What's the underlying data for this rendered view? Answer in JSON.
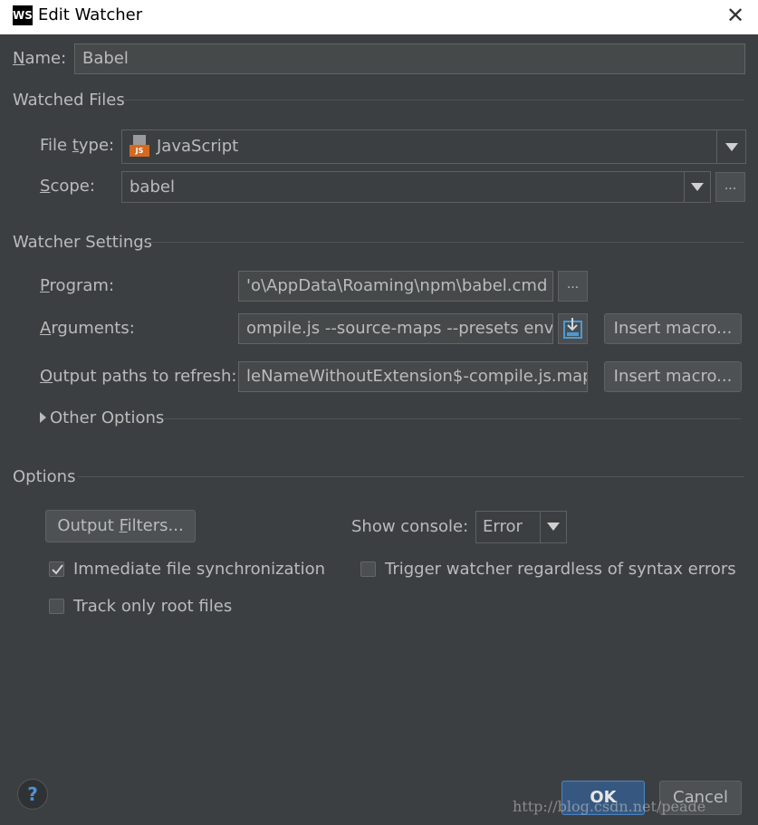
{
  "window": {
    "title": "Edit Watcher",
    "app_icon": "WS"
  },
  "name": {
    "label_prefix": "N",
    "label_rest": "ame:",
    "value": "Babel"
  },
  "watched_files": {
    "heading": "Watched Files",
    "file_type": {
      "label_pre": "File ",
      "label_u": "t",
      "label_post": "ype:",
      "value": "JavaScript",
      "badge": "JS"
    },
    "scope": {
      "label_u": "S",
      "label_post": "cope:",
      "value": "babel"
    }
  },
  "watcher_settings": {
    "heading": "Watcher Settings",
    "program": {
      "label_u": "P",
      "label_post": "rogram:",
      "value": "'o\\AppData\\Roaming\\npm\\babel.cmd"
    },
    "arguments": {
      "label_u": "A",
      "label_post": "rguments:",
      "value": "ompile.js --source-maps --presets env"
    },
    "output_paths": {
      "label_u": "O",
      "label_post": "utput paths to refresh:",
      "value": "leNameWithoutExtension$-compile.js.map"
    },
    "insert_macro_label": "Insert macro...",
    "other_options": "Other Options"
  },
  "options": {
    "heading": "Options",
    "output_filters_pre": "Output ",
    "output_filters_u": "F",
    "output_filters_post": "ilters...",
    "show_console_label": "Show console:",
    "show_console_value": "Error",
    "immediate_sync": {
      "label": "Immediate file synchronization",
      "checked": true
    },
    "trigger_watcher": {
      "label": "Trigger watcher regardless of syntax errors",
      "checked": false
    },
    "track_root": {
      "label": "Track only root files",
      "checked": false
    }
  },
  "footer": {
    "help": "?",
    "ok": "OK",
    "cancel": "Cancel",
    "watermark": "http://blog.csdn.net/peade"
  },
  "ellipsis": "..."
}
